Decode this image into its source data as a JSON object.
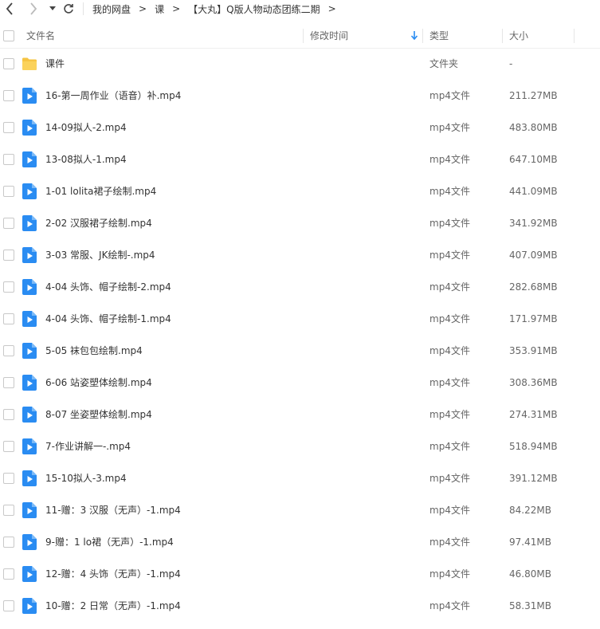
{
  "breadcrumb": {
    "items": [
      "我的网盘",
      "课",
      "【大丸】Q版人物动态团练二期"
    ],
    "separator": ">"
  },
  "header": {
    "col_name": "文件名",
    "col_modified": "修改时间",
    "col_type": "类型",
    "col_size": "大小",
    "sort_icon": "arrow-down-icon"
  },
  "colors": {
    "accent": "#2a8cf2",
    "folder": "#f6c443",
    "text": "#333333",
    "muted": "#666666"
  },
  "files": [
    {
      "name": "课件",
      "type": "文件夹",
      "size": "-",
      "icon": "folder-icon"
    },
    {
      "name": "16-第一周作业（语音）补.mp4",
      "type": "mp4文件",
      "size": "211.27MB",
      "icon": "video-file-icon"
    },
    {
      "name": "14-09拟人-2.mp4",
      "type": "mp4文件",
      "size": "483.80MB",
      "icon": "video-file-icon"
    },
    {
      "name": "13-08拟人-1.mp4",
      "type": "mp4文件",
      "size": "647.10MB",
      "icon": "video-file-icon"
    },
    {
      "name": "1-01 lolita裙子绘制.mp4",
      "type": "mp4文件",
      "size": "441.09MB",
      "icon": "video-file-icon"
    },
    {
      "name": "2-02 汉服裙子绘制.mp4",
      "type": "mp4文件",
      "size": "341.92MB",
      "icon": "video-file-icon"
    },
    {
      "name": "3-03 常服、JK绘制-.mp4",
      "type": "mp4文件",
      "size": "407.09MB",
      "icon": "video-file-icon"
    },
    {
      "name": "4-04 头饰、帽子绘制-2.mp4",
      "type": "mp4文件",
      "size": "282.68MB",
      "icon": "video-file-icon"
    },
    {
      "name": "4-04 头饰、帽子绘制-1.mp4",
      "type": "mp4文件",
      "size": "171.97MB",
      "icon": "video-file-icon"
    },
    {
      "name": "5-05 袜包包绘制.mp4",
      "type": "mp4文件",
      "size": "353.91MB",
      "icon": "video-file-icon"
    },
    {
      "name": "6-06 站姿塑体绘制.mp4",
      "type": "mp4文件",
      "size": "308.36MB",
      "icon": "video-file-icon"
    },
    {
      "name": "8-07 坐姿塑体绘制.mp4",
      "type": "mp4文件",
      "size": "274.31MB",
      "icon": "video-file-icon"
    },
    {
      "name": "7-作业讲解一-.mp4",
      "type": "mp4文件",
      "size": "518.94MB",
      "icon": "video-file-icon"
    },
    {
      "name": "15-10拟人-3.mp4",
      "type": "mp4文件",
      "size": "391.12MB",
      "icon": "video-file-icon"
    },
    {
      "name": "11-赠：3 汉服（无声）-1.mp4",
      "type": "mp4文件",
      "size": "84.22MB",
      "icon": "video-file-icon"
    },
    {
      "name": "9-赠：1 lo裙（无声）-1.mp4",
      "type": "mp4文件",
      "size": "97.41MB",
      "icon": "video-file-icon"
    },
    {
      "name": "12-赠：4  头饰（无声）-1.mp4",
      "type": "mp4文件",
      "size": "46.80MB",
      "icon": "video-file-icon"
    },
    {
      "name": "10-赠：2 日常（无声）-1.mp4",
      "type": "mp4文件",
      "size": "58.31MB",
      "icon": "video-file-icon"
    }
  ]
}
